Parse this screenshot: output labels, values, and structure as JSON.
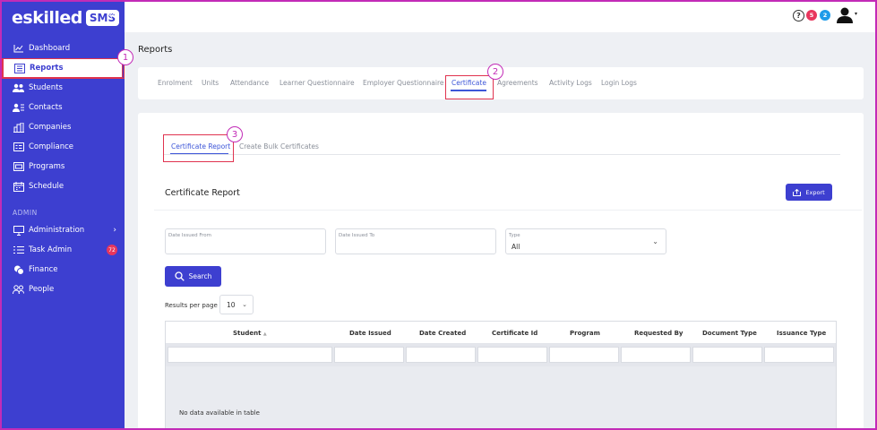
{
  "brand": {
    "logo_text": "eskilled",
    "badge": "SMS",
    "collapse_glyph": "«"
  },
  "sidebar": {
    "items": [
      {
        "label": "Dashboard",
        "icon": "chart-line-icon"
      },
      {
        "label": "Reports",
        "icon": "report-icon"
      },
      {
        "label": "Students",
        "icon": "users-icon"
      },
      {
        "label": "Contacts",
        "icon": "contacts-icon"
      },
      {
        "label": "Companies",
        "icon": "building-icon"
      },
      {
        "label": "Compliance",
        "icon": "compliance-icon"
      },
      {
        "label": "Programs",
        "icon": "programs-icon"
      },
      {
        "label": "Schedule",
        "icon": "calendar-icon"
      }
    ],
    "admin_section": "ADMIN",
    "admin_items": [
      {
        "label": "Administration",
        "icon": "monitor-icon",
        "chevron": "›"
      },
      {
        "label": "Task Admin",
        "icon": "list-icon",
        "badge": "72"
      },
      {
        "label": "Finance",
        "icon": "coins-icon"
      },
      {
        "label": "People",
        "icon": "people-icon"
      }
    ]
  },
  "topbar": {
    "help": "?",
    "notif_red": "5",
    "notif_blue": "2",
    "caret": "▾"
  },
  "page_title": "Reports",
  "tabs": [
    "Enrolment",
    "Units",
    "Attendance",
    "Learner Questionnaire",
    "Employer Questionnaire",
    "Certificate",
    "Agreements",
    "Activity Logs",
    "Login Logs"
  ],
  "subtabs": [
    "Certificate Report",
    "Create Bulk Certificates"
  ],
  "report": {
    "title": "Certificate Report",
    "export_label": "Export",
    "date_from_label": "Date Issued From",
    "date_to_label": "Date Issued To",
    "type_label": "Type",
    "type_value": "All",
    "search_label": "Search",
    "rpp_label": "Results per page",
    "rpp_value": "10",
    "columns": [
      "Student",
      "Date Issued",
      "Date Created",
      "Certificate Id",
      "Program",
      "Requested By",
      "Document Type",
      "Issuance Type"
    ],
    "sort_glyph": "▲",
    "empty_text": "No data available in table"
  },
  "callouts": [
    "1",
    "2",
    "3"
  ],
  "colors": {
    "sidebar": "#3d3fd0",
    "accent": "#3d56d8",
    "highlight": "#e0334f",
    "callout": "#c22bb7"
  }
}
